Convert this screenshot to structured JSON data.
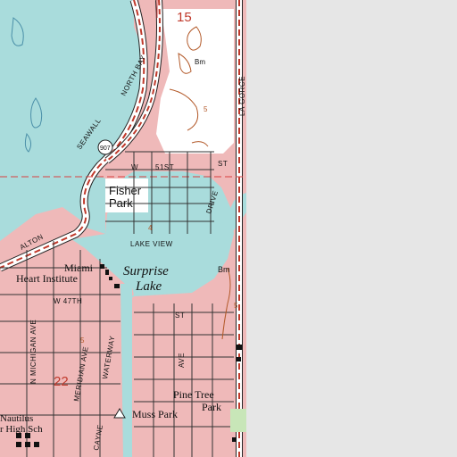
{
  "map": {
    "colors": {
      "water": "#a9dcdc",
      "urban": "#efb9b9",
      "land": "#ffffff",
      "road": "#ffffff",
      "road_edge": "#222222",
      "highway": "#c0392b",
      "contour": "#b35a2a",
      "grid_line": "#d94040",
      "blank": "#e6e6e6",
      "vegetation": "#c8e6b8"
    },
    "labels": {
      "section_15": "15",
      "section_22": "22",
      "north_bay": "NORTH BAY",
      "seawall": "SEAWALL",
      "route_907": "907",
      "st_51": "51ST",
      "st_w": "W",
      "st_suffix": "ST",
      "fisher_1": "Fisher",
      "fisher_2": "Park",
      "drive": "DRIVE",
      "lake_view": "LAKE VIEW",
      "la_gorce": "LA GORCE",
      "alton": "ALTON",
      "miami": "Miami",
      "heart_institute": "Heart Institute",
      "surprise": "Surprise",
      "lake": "Lake",
      "st_47": "W 47TH",
      "michigan": "N MICHIGAN AVE",
      "meridian": "MERIDIAN AVE",
      "waterway": "WATERWAY",
      "cayne": "CAYNE",
      "st_east": "ST",
      "ave": "AVE",
      "pine_tree": "Pine Tree",
      "pine_park": "Park",
      "muss_park": "Muss Park",
      "nautilus": "Nautilus",
      "nautilus_2": "r High Sch",
      "elev_5a": "5",
      "elev_5b": "5",
      "elev_4": "4",
      "elev_5c": "5",
      "bm": "Bm",
      "bm2": "Bm",
      "sd": "5"
    }
  }
}
